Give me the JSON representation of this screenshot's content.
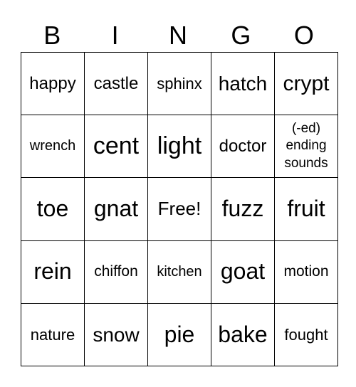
{
  "header": [
    "B",
    "I",
    "N",
    "G",
    "O"
  ],
  "rows": [
    [
      "happy",
      "castle",
      "sphinx",
      "hatch",
      "crypt"
    ],
    [
      "wrench",
      "cent",
      "light",
      "doctor",
      "(-ed) ending sounds"
    ],
    [
      "toe",
      "gnat",
      "Free!",
      "fuzz",
      "fruit"
    ],
    [
      "rein",
      "chiffon",
      "kitchen",
      "goat",
      "motion"
    ],
    [
      "nature",
      "snow",
      "pie",
      "bake",
      "fought"
    ]
  ]
}
